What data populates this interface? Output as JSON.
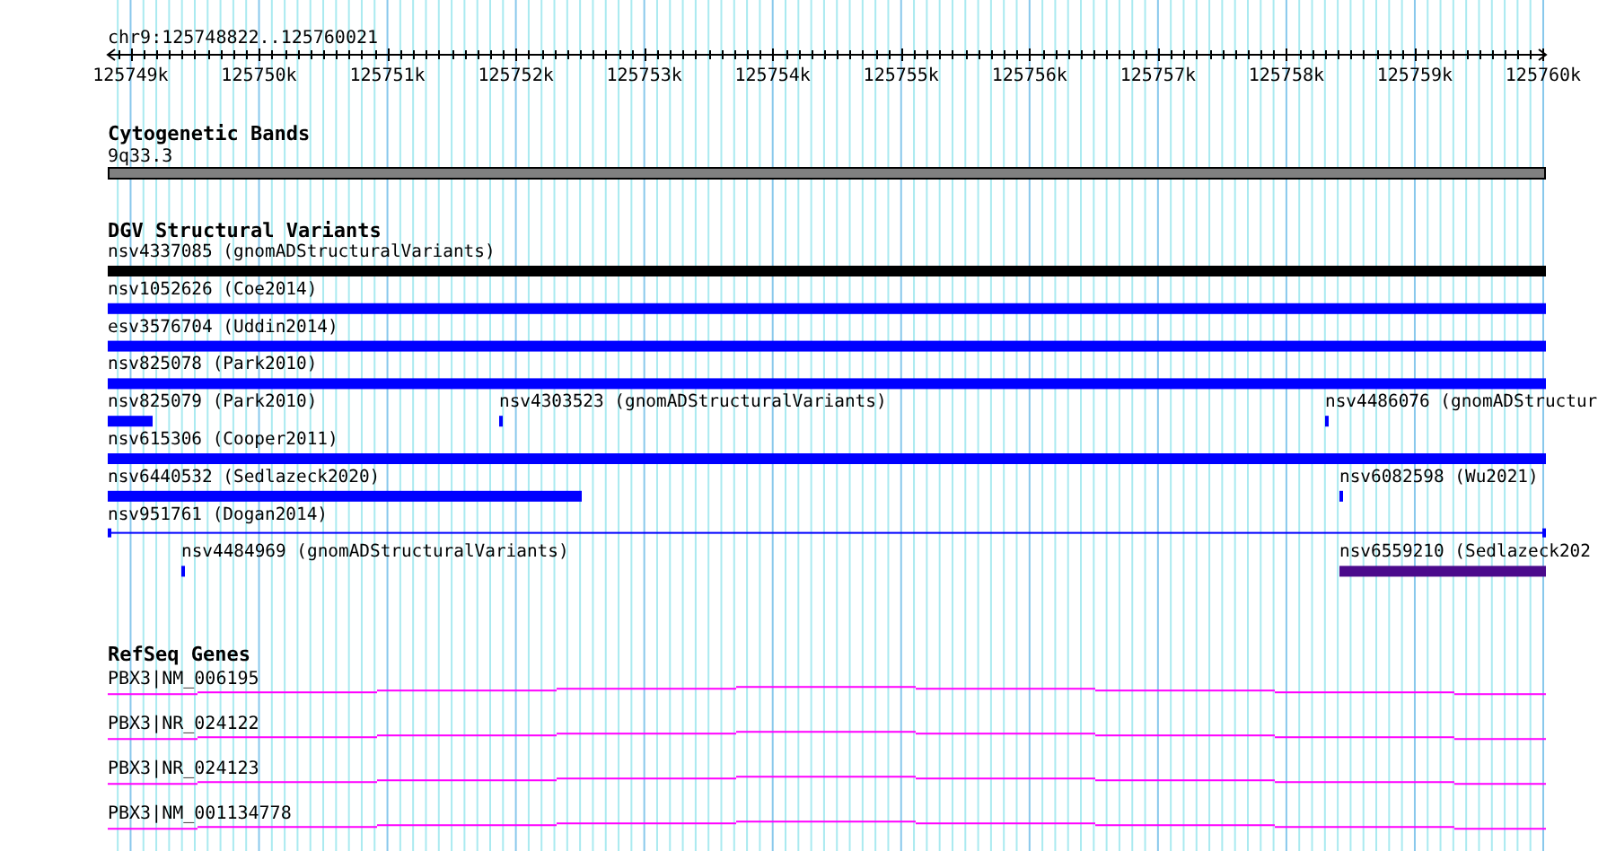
{
  "ruler": {
    "title": "chr9:125748822..125760021",
    "ticks": [
      "125749k",
      "125750k",
      "125751k",
      "125752k",
      "125753k",
      "125754k",
      "125755k",
      "125756k",
      "125757k",
      "125758k",
      "125759k",
      "125760k"
    ]
  },
  "tracks": [
    {
      "kind": "cytoband",
      "title": "Cytogenetic Bands",
      "bands": [
        {
          "label": "9q33.3",
          "color": "#808080"
        }
      ]
    },
    {
      "kind": "variants",
      "title": "DGV Structural Variants",
      "rows": [
        [
          {
            "label": "nsv4337085 (gnomADStructuralVariants)",
            "color": "#000000",
            "kind": "bar"
          }
        ],
        [
          {
            "label": "nsv1052626 (Coe2014)",
            "color": "#0000ff",
            "kind": "bar"
          }
        ],
        [
          {
            "label": "esv3576704 (Uddin2014)",
            "color": "#0000ff",
            "kind": "bar"
          }
        ],
        [
          {
            "label": "nsv825078 (Park2010)",
            "color": "#0000ff",
            "kind": "bar"
          }
        ],
        [
          {
            "label": "nsv825079 (Park2010)",
            "color": "#0000ff",
            "kind": "bar"
          },
          {
            "label": "nsv4303523 (gnomADStructuralVariants)",
            "color": "#0000ff",
            "kind": "bar"
          },
          {
            "label": "nsv4486076 (gnomADStructur",
            "color": "#0000ff",
            "kind": "bar"
          }
        ],
        [
          {
            "label": "nsv615306 (Cooper2011)",
            "color": "#0000ff",
            "kind": "bar"
          }
        ],
        [
          {
            "label": "nsv6440532 (Sedlazeck2020)",
            "color": "#0000ff",
            "kind": "bar"
          },
          {
            "label": "nsv6082598 (Wu2021)",
            "color": "#0000ff",
            "kind": "bar"
          }
        ],
        [
          {
            "label": "nsv951761 (Dogan2014)",
            "color": "#0000ff",
            "kind": "line"
          }
        ],
        [
          {
            "label": "nsv4484969 (gnomADStructuralVariants)",
            "color": "#0000ff",
            "kind": "bar"
          },
          {
            "label": "nsv6559210 (Sedlazeck202",
            "color": "#4b0a8c",
            "kind": "bar"
          }
        ]
      ]
    },
    {
      "kind": "genes",
      "title": "RefSeq Genes",
      "genes": [
        {
          "label": "PBX3|NM_006195"
        },
        {
          "label": "PBX3|NR_024122"
        },
        {
          "label": "PBX3|NR_024123"
        },
        {
          "label": "PBX3|NM_001134778"
        }
      ]
    }
  ]
}
